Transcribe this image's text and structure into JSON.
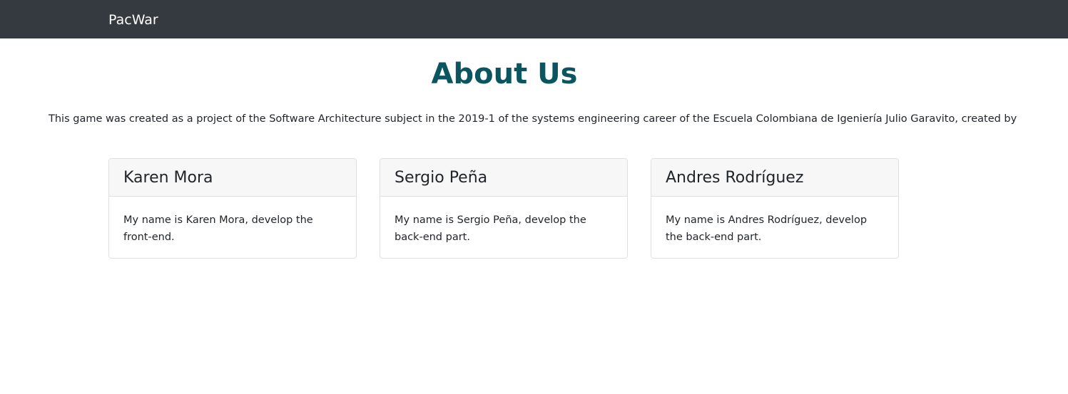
{
  "navbar": {
    "brand": "PacWar"
  },
  "page": {
    "title": "About Us",
    "intro": "This game was created as a project of the Software Architecture subject in the 2019-1 of the systems engineering career of the Escuela Colombiana de Igeniería Julio Garavito, created by"
  },
  "team": [
    {
      "name": "Karen Mora",
      "description": "My name is Karen Mora, develop the front-end."
    },
    {
      "name": "Sergio Peña",
      "description": "My name is Sergio Peña, develop the back-end part."
    },
    {
      "name": "Andres Rodríguez",
      "description": "My name is Andres Rodríguez, develop the back-end part."
    }
  ]
}
